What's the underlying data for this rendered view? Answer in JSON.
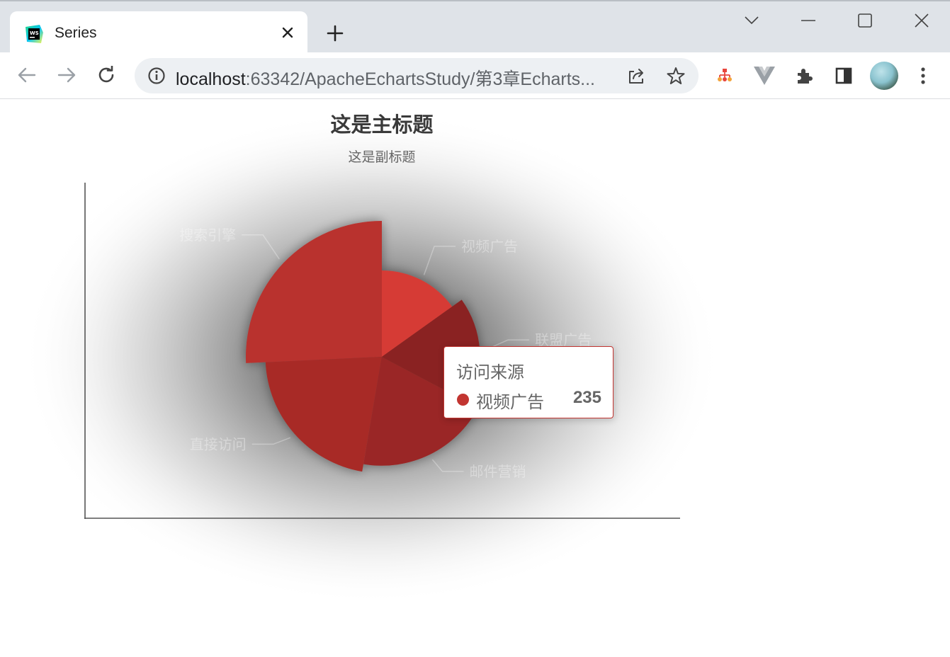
{
  "browser": {
    "tab_title": "Series",
    "tab_favicon": "webstorm-icon",
    "url_host": "localhost",
    "url_rest": ":63342/ApacheEchartsStudy/第3章Echarts..."
  },
  "chart_data": {
    "type": "pie",
    "roseType": "radius",
    "title": "这是主标题",
    "subtitle": "这是副标题",
    "series_name": "访问来源",
    "slices": [
      {
        "name": "视频广告",
        "value": 235
      },
      {
        "name": "联盟广告",
        "value": 274
      },
      {
        "name": "邮件营销",
        "value": 310
      },
      {
        "name": "直接访问",
        "value": 335
      },
      {
        "name": "搜索引擎",
        "value": 400
      }
    ],
    "colors": [
      "#d63b34",
      "#8a2420",
      "#9a2825",
      "#a82b28",
      "#b9312e"
    ],
    "tooltip": {
      "title": "访问来源",
      "name": "视频广告",
      "value": "235"
    },
    "axes_visible": true,
    "background": "radial-shadow"
  }
}
